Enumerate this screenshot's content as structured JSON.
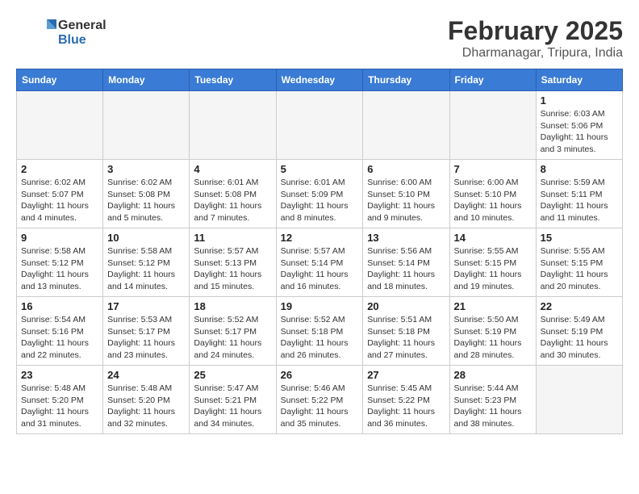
{
  "header": {
    "logo_general": "General",
    "logo_blue": "Blue",
    "month_title": "February 2025",
    "location": "Dharmanagar, Tripura, India"
  },
  "weekdays": [
    "Sunday",
    "Monday",
    "Tuesday",
    "Wednesday",
    "Thursday",
    "Friday",
    "Saturday"
  ],
  "weeks": [
    [
      {
        "day": "",
        "info": ""
      },
      {
        "day": "",
        "info": ""
      },
      {
        "day": "",
        "info": ""
      },
      {
        "day": "",
        "info": ""
      },
      {
        "day": "",
        "info": ""
      },
      {
        "day": "",
        "info": ""
      },
      {
        "day": "1",
        "info": "Sunrise: 6:03 AM\nSunset: 5:06 PM\nDaylight: 11 hours and 3 minutes."
      }
    ],
    [
      {
        "day": "2",
        "info": "Sunrise: 6:02 AM\nSunset: 5:07 PM\nDaylight: 11 hours and 4 minutes."
      },
      {
        "day": "3",
        "info": "Sunrise: 6:02 AM\nSunset: 5:08 PM\nDaylight: 11 hours and 5 minutes."
      },
      {
        "day": "4",
        "info": "Sunrise: 6:01 AM\nSunset: 5:08 PM\nDaylight: 11 hours and 7 minutes."
      },
      {
        "day": "5",
        "info": "Sunrise: 6:01 AM\nSunset: 5:09 PM\nDaylight: 11 hours and 8 minutes."
      },
      {
        "day": "6",
        "info": "Sunrise: 6:00 AM\nSunset: 5:10 PM\nDaylight: 11 hours and 9 minutes."
      },
      {
        "day": "7",
        "info": "Sunrise: 6:00 AM\nSunset: 5:10 PM\nDaylight: 11 hours and 10 minutes."
      },
      {
        "day": "8",
        "info": "Sunrise: 5:59 AM\nSunset: 5:11 PM\nDaylight: 11 hours and 11 minutes."
      }
    ],
    [
      {
        "day": "9",
        "info": "Sunrise: 5:58 AM\nSunset: 5:12 PM\nDaylight: 11 hours and 13 minutes."
      },
      {
        "day": "10",
        "info": "Sunrise: 5:58 AM\nSunset: 5:12 PM\nDaylight: 11 hours and 14 minutes."
      },
      {
        "day": "11",
        "info": "Sunrise: 5:57 AM\nSunset: 5:13 PM\nDaylight: 11 hours and 15 minutes."
      },
      {
        "day": "12",
        "info": "Sunrise: 5:57 AM\nSunset: 5:14 PM\nDaylight: 11 hours and 16 minutes."
      },
      {
        "day": "13",
        "info": "Sunrise: 5:56 AM\nSunset: 5:14 PM\nDaylight: 11 hours and 18 minutes."
      },
      {
        "day": "14",
        "info": "Sunrise: 5:55 AM\nSunset: 5:15 PM\nDaylight: 11 hours and 19 minutes."
      },
      {
        "day": "15",
        "info": "Sunrise: 5:55 AM\nSunset: 5:15 PM\nDaylight: 11 hours and 20 minutes."
      }
    ],
    [
      {
        "day": "16",
        "info": "Sunrise: 5:54 AM\nSunset: 5:16 PM\nDaylight: 11 hours and 22 minutes."
      },
      {
        "day": "17",
        "info": "Sunrise: 5:53 AM\nSunset: 5:17 PM\nDaylight: 11 hours and 23 minutes."
      },
      {
        "day": "18",
        "info": "Sunrise: 5:52 AM\nSunset: 5:17 PM\nDaylight: 11 hours and 24 minutes."
      },
      {
        "day": "19",
        "info": "Sunrise: 5:52 AM\nSunset: 5:18 PM\nDaylight: 11 hours and 26 minutes."
      },
      {
        "day": "20",
        "info": "Sunrise: 5:51 AM\nSunset: 5:18 PM\nDaylight: 11 hours and 27 minutes."
      },
      {
        "day": "21",
        "info": "Sunrise: 5:50 AM\nSunset: 5:19 PM\nDaylight: 11 hours and 28 minutes."
      },
      {
        "day": "22",
        "info": "Sunrise: 5:49 AM\nSunset: 5:19 PM\nDaylight: 11 hours and 30 minutes."
      }
    ],
    [
      {
        "day": "23",
        "info": "Sunrise: 5:48 AM\nSunset: 5:20 PM\nDaylight: 11 hours and 31 minutes."
      },
      {
        "day": "24",
        "info": "Sunrise: 5:48 AM\nSunset: 5:20 PM\nDaylight: 11 hours and 32 minutes."
      },
      {
        "day": "25",
        "info": "Sunrise: 5:47 AM\nSunset: 5:21 PM\nDaylight: 11 hours and 34 minutes."
      },
      {
        "day": "26",
        "info": "Sunrise: 5:46 AM\nSunset: 5:22 PM\nDaylight: 11 hours and 35 minutes."
      },
      {
        "day": "27",
        "info": "Sunrise: 5:45 AM\nSunset: 5:22 PM\nDaylight: 11 hours and 36 minutes."
      },
      {
        "day": "28",
        "info": "Sunrise: 5:44 AM\nSunset: 5:23 PM\nDaylight: 11 hours and 38 minutes."
      },
      {
        "day": "",
        "info": ""
      }
    ]
  ]
}
